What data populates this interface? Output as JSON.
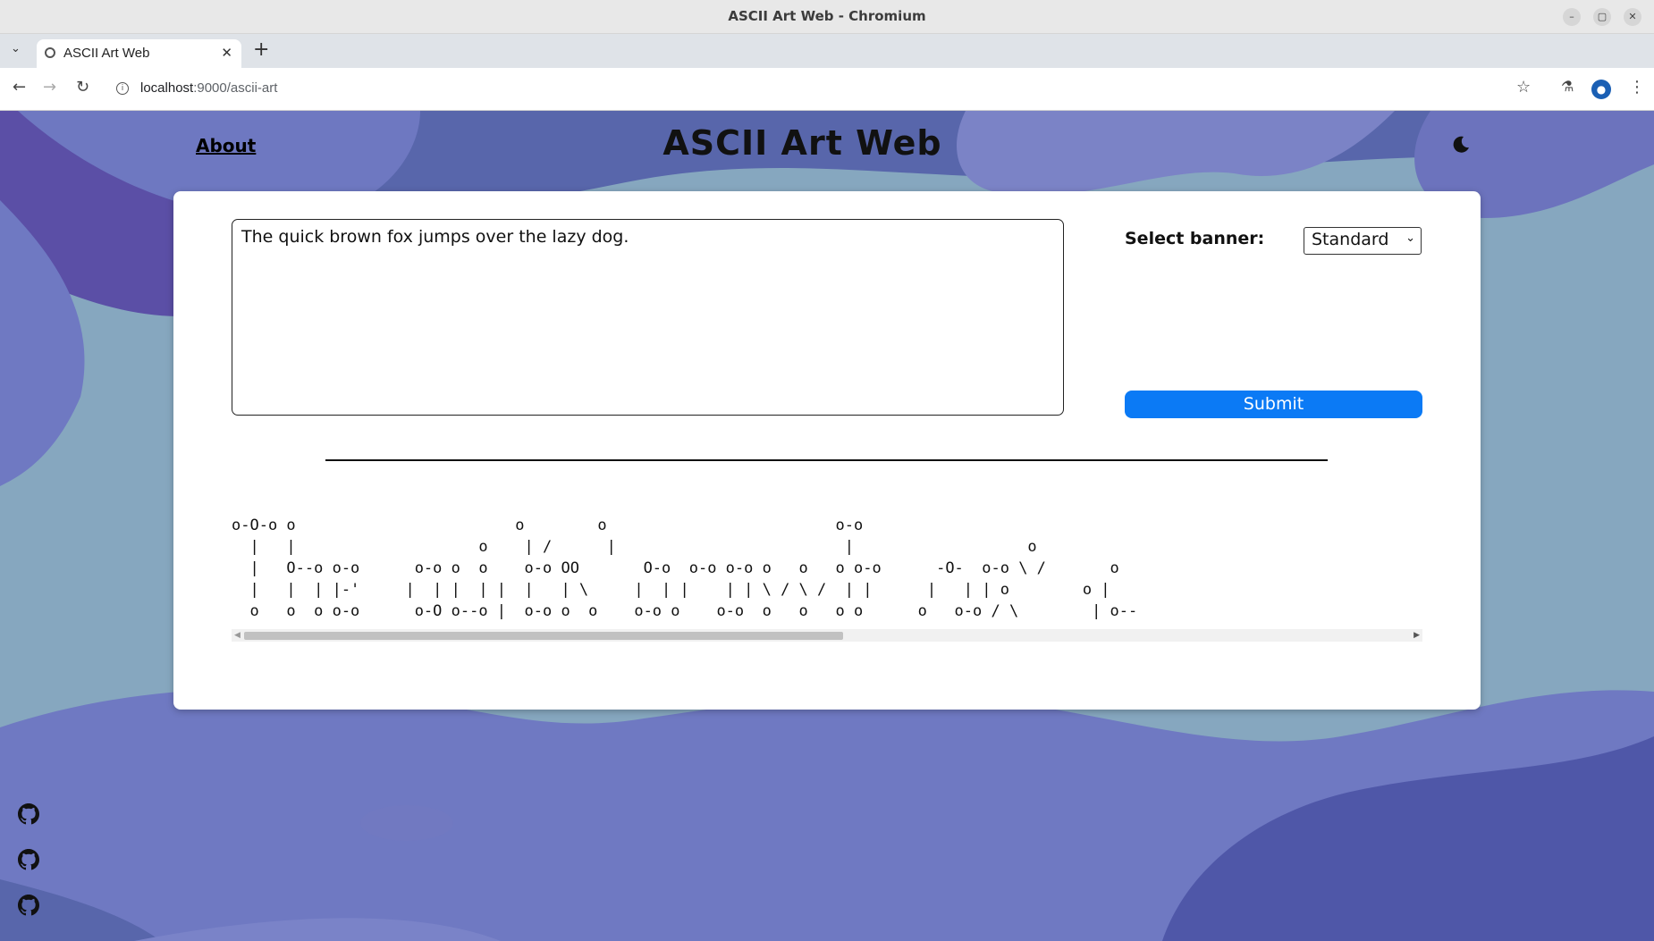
{
  "browser": {
    "window_title": "ASCII Art Web - Chromium",
    "tab_title": "ASCII Art Web",
    "url_host": "localhost",
    "url_path": ":9000/ascii-art"
  },
  "header": {
    "about_label": "About",
    "site_title": "ASCII Art Web"
  },
  "form": {
    "input_text": "The quick brown fox jumps over the lazy dog.",
    "banner_label": "Select banner:",
    "banner_selected": "Standard",
    "submit_label": "Submit"
  },
  "output": {
    "ascii_art": "o-O-o o                        o        o                         o-o                 \n  |   |                    o    | /      |                         |                   o   \n  |   O--o o-o      o-o o  o    o-o OO       O-o  o-o o-o o   o   o o-o      -O-  o-o \\ /       o \n  |   |  | |-'     |  | |  | |  |   | \\     |  | |    | | \\ / \\ /  | |      |   | | o        o | \n  o   o  o o-o      o-O o--o |  o-o o  o    o-o o    o-o  o   o   o o      o   o-o / \\        | o--\n                      |                                                            o   o          \n                      o                                                             o-o          "
  },
  "colors": {
    "accent": "#0b7af5",
    "page_bg": "#86a7bf",
    "blob_purple": "#6f79c2",
    "blob_dark": "#4f57a8"
  },
  "icons": {
    "theme": "moon-icon",
    "footer": [
      "github-icon",
      "github-icon",
      "github-icon"
    ]
  }
}
